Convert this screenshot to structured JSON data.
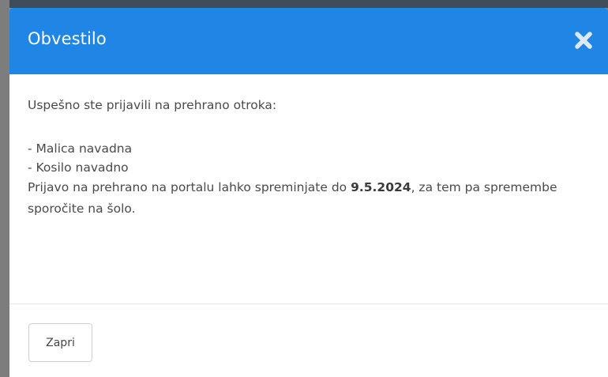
{
  "modal": {
    "title": "Obvestilo",
    "close_icon": "close-x-icon",
    "body": {
      "intro": "Uspešno ste prijavili na prehrano otroka:",
      "items": [
        "- Malica navadna",
        "- Kosilo navadno"
      ],
      "note_before": "Prijavo na prehrano na portalu lahko spreminjate do ",
      "note_date": "9.5.2024",
      "note_after": ", za tem pa spremembe sporočite na šolo."
    },
    "footer": {
      "close_label": "Zapri"
    }
  },
  "colors": {
    "header": "#1f86e6",
    "header_text": "#ffffff",
    "body_text": "#4a4a4a"
  }
}
